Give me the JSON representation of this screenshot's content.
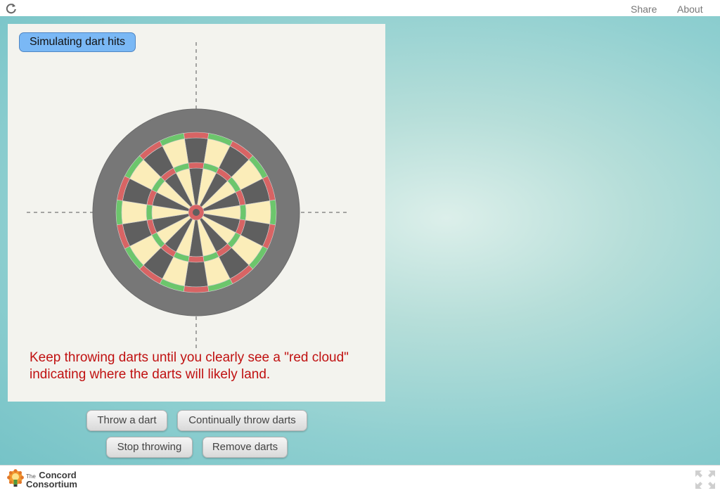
{
  "topbar": {
    "reload_icon": "reload-icon",
    "share_label": "Share",
    "about_label": "About"
  },
  "panel": {
    "title": "Simulating dart hits",
    "instruction_line1": "Keep throwing darts until you clearly see a \"red cloud\"",
    "instruction_line2": "indicating where the darts will likely land."
  },
  "dartboard": {
    "segments": 20,
    "colors": {
      "surround": "#777777",
      "dark_segment": "#5f5f5f",
      "light_segment": "#fbedb9",
      "ring_red": "#d86464",
      "ring_green": "#6cc66c",
      "background": "#f3f3ee"
    }
  },
  "buttons": {
    "throw_dart": "Throw a dart",
    "continually_throw": "Continually throw darts",
    "stop_throwing": "Stop throwing",
    "remove_darts": "Remove darts"
  },
  "footer": {
    "logo_line1": "The",
    "logo_line2": "Concord",
    "logo_line3": "Consortium",
    "fullscreen_icon": "fullscreen-icon"
  }
}
